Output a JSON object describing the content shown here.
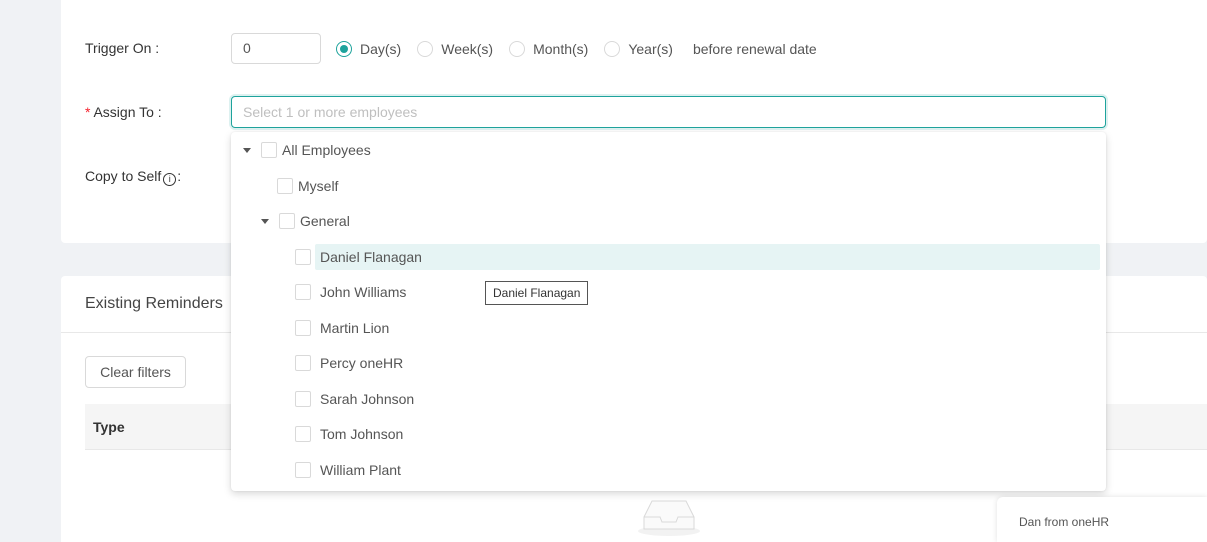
{
  "form": {
    "trigger_label": "Trigger On :",
    "trigger_value": "0",
    "units": [
      "Day(s)",
      "Week(s)",
      "Month(s)",
      "Year(s)"
    ],
    "selected_unit": "Day(s)",
    "suffix": "before renewal date",
    "assign_required_mark": "*",
    "assign_label": "Assign To :",
    "assign_placeholder": "Select 1 or more employees",
    "copy_label": "Copy to Self",
    "copy_colon": ":"
  },
  "tree": {
    "root": "All Employees",
    "myself": "Myself",
    "group": "General",
    "employees": [
      "Daniel Flanagan",
      "John Williams",
      "Martin Lion",
      "Percy oneHR",
      "Sarah Johnson",
      "Tom Johnson",
      "William Plant"
    ],
    "hovered": "Daniel Flanagan"
  },
  "tooltip": "Daniel Flanagan",
  "reminders": {
    "title": "Existing Reminders",
    "clear_filters": "Clear filters",
    "col_type": "Type"
  },
  "chat": {
    "text": "Dan from oneHR"
  },
  "colors": {
    "accent": "#1ea39c",
    "hover_bg": "#e6f4f4"
  }
}
